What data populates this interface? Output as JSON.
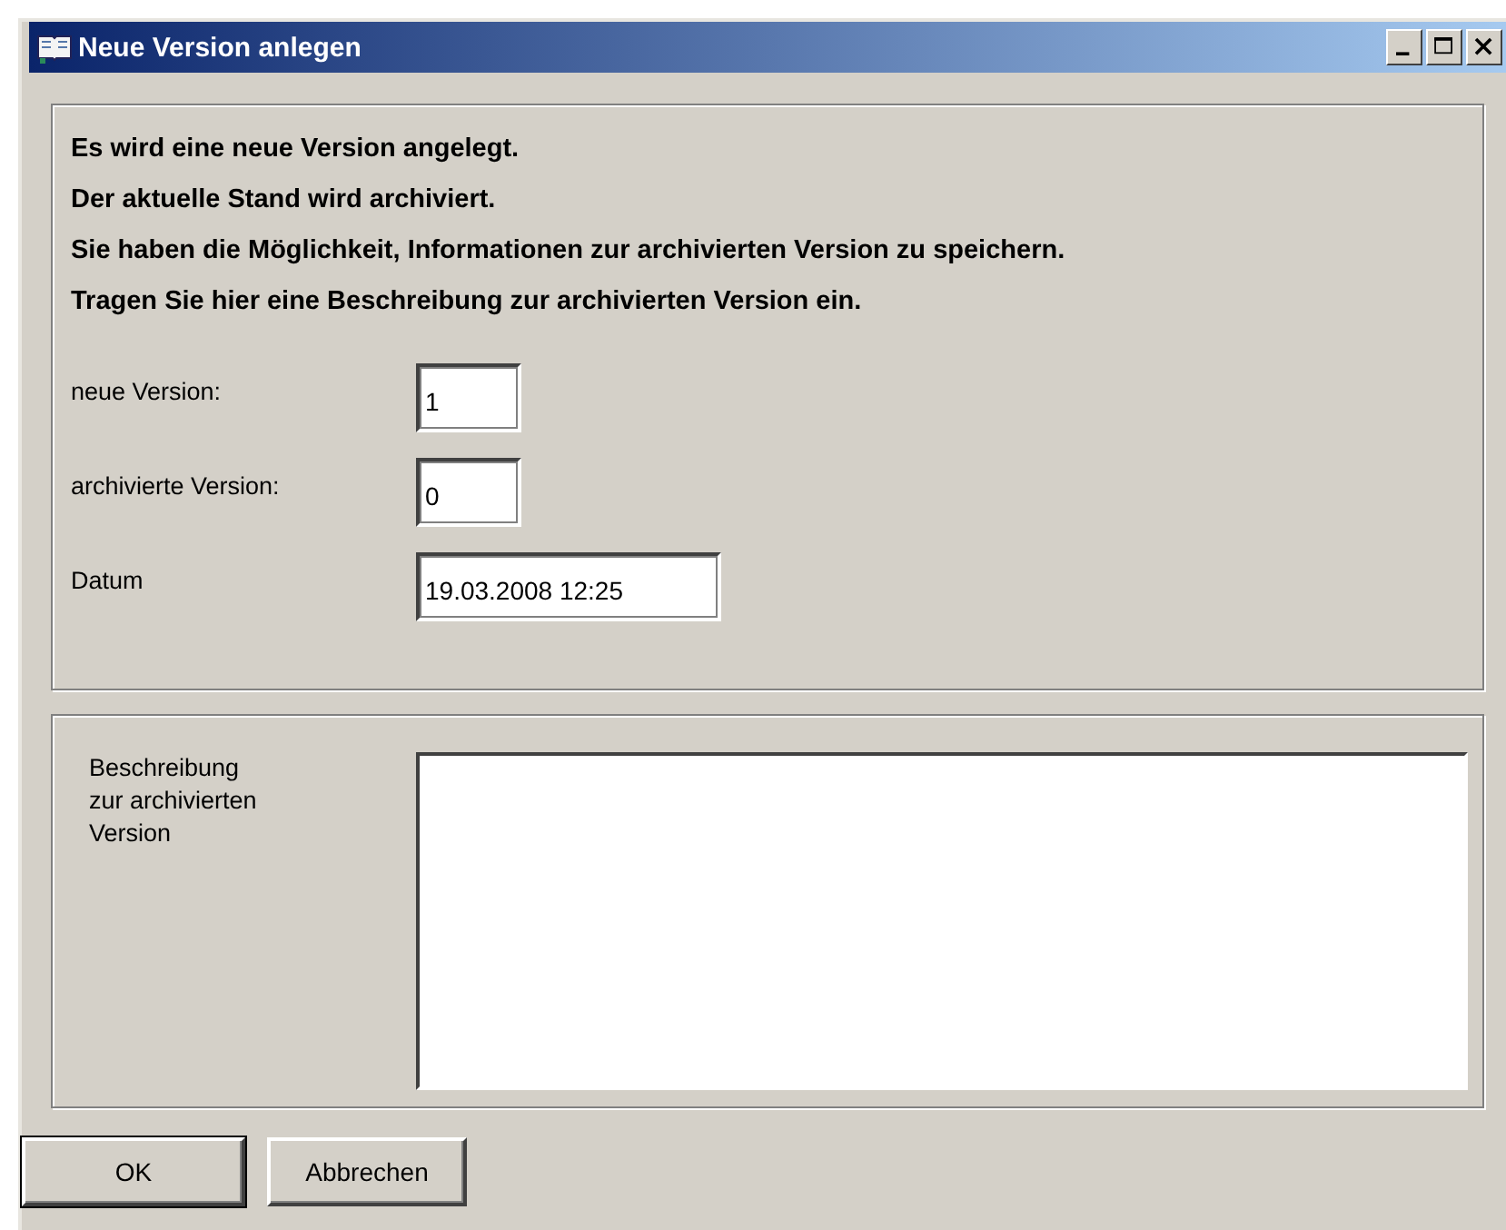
{
  "window": {
    "title": "Neue Version anlegen"
  },
  "messages": [
    "Es wird eine neue Version angelegt.",
    "Der aktuelle Stand wird archiviert.",
    "Sie haben die Möglichkeit, Informationen zur archivierten Version zu speichern.",
    "Tragen Sie hier eine Beschreibung zur archivierten Version ein."
  ],
  "fields": [
    {
      "label": "neue Version:",
      "value": "1",
      "kind": "short"
    },
    {
      "label": "archivierte Version:",
      "value": "0",
      "kind": "short"
    },
    {
      "label": "Datum",
      "value": "19.03.2008 12:25",
      "kind": "long"
    }
  ],
  "description": {
    "label": "Beschreibung\nzur archivierten\nVersion"
  },
  "buttons": [
    {
      "label": "OK",
      "default": true
    },
    {
      "label": "Abbrechen",
      "default": false
    }
  ]
}
